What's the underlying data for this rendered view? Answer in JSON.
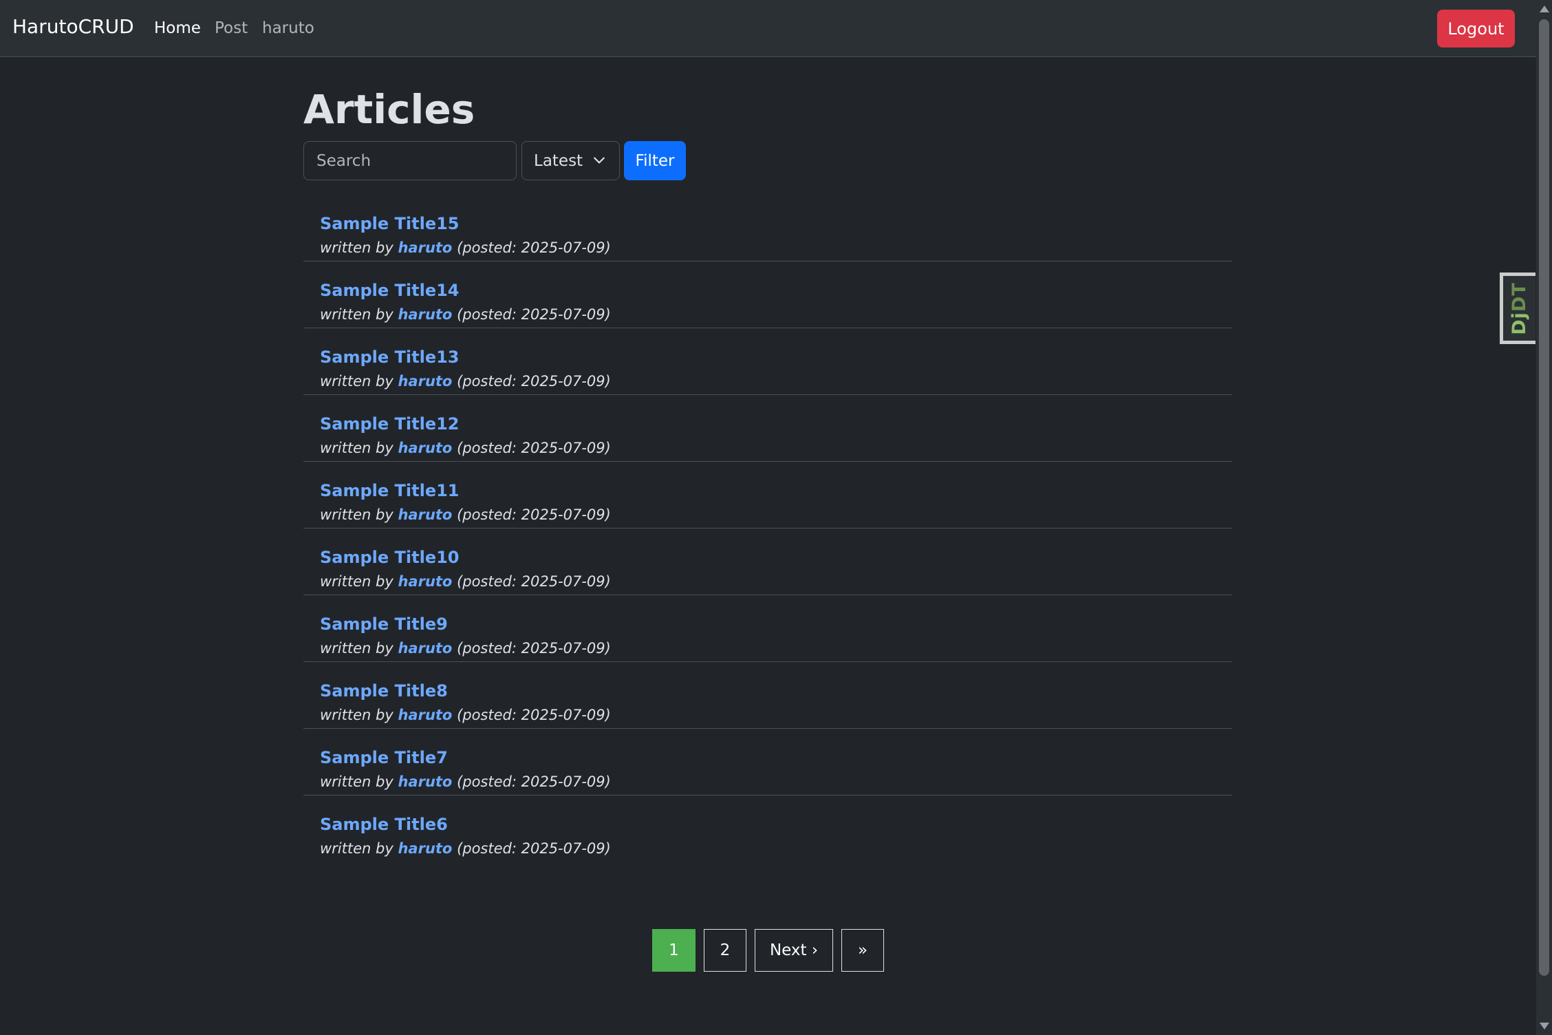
{
  "navbar": {
    "brand": "HarutoCRUD",
    "links": [
      {
        "label": "Home",
        "active": true
      },
      {
        "label": "Post",
        "active": false
      },
      {
        "label": "haruto",
        "active": false
      }
    ],
    "logout_label": "Logout"
  },
  "main": {
    "heading": "Articles",
    "search": {
      "placeholder": "Search",
      "value": ""
    },
    "sort": {
      "selected": "Latest"
    },
    "filter_label": "Filter"
  },
  "articles": [
    {
      "title": "Sample Title15",
      "by": "written by",
      "author": "haruto",
      "posted": "(posted: 2025-07-09)"
    },
    {
      "title": "Sample Title14",
      "by": "written by",
      "author": "haruto",
      "posted": "(posted: 2025-07-09)"
    },
    {
      "title": "Sample Title13",
      "by": "written by",
      "author": "haruto",
      "posted": "(posted: 2025-07-09)"
    },
    {
      "title": "Sample Title12",
      "by": "written by",
      "author": "haruto",
      "posted": "(posted: 2025-07-09)"
    },
    {
      "title": "Sample Title11",
      "by": "written by",
      "author": "haruto",
      "posted": "(posted: 2025-07-09)"
    },
    {
      "title": "Sample Title10",
      "by": "written by",
      "author": "haruto",
      "posted": "(posted: 2025-07-09)"
    },
    {
      "title": "Sample Title9",
      "by": "written by",
      "author": "haruto",
      "posted": "(posted: 2025-07-09)"
    },
    {
      "title": "Sample Title8",
      "by": "written by",
      "author": "haruto",
      "posted": "(posted: 2025-07-09)"
    },
    {
      "title": "Sample Title7",
      "by": "written by",
      "author": "haruto",
      "posted": "(posted: 2025-07-09)"
    },
    {
      "title": "Sample Title6",
      "by": "written by",
      "author": "haruto",
      "posted": "(posted: 2025-07-09)"
    }
  ],
  "pagination": {
    "current": "1",
    "page2": "2",
    "next": "Next ›",
    "last": "»"
  },
  "djdt": {
    "label_dj": "Dj",
    "label_dt": "DT"
  },
  "colors": {
    "background": "#212529",
    "navbar": "#2b3035",
    "link": "#6ea8fe",
    "logout": "#dc3545",
    "filter": "#0d6efd",
    "current_page": "#4caf50"
  }
}
